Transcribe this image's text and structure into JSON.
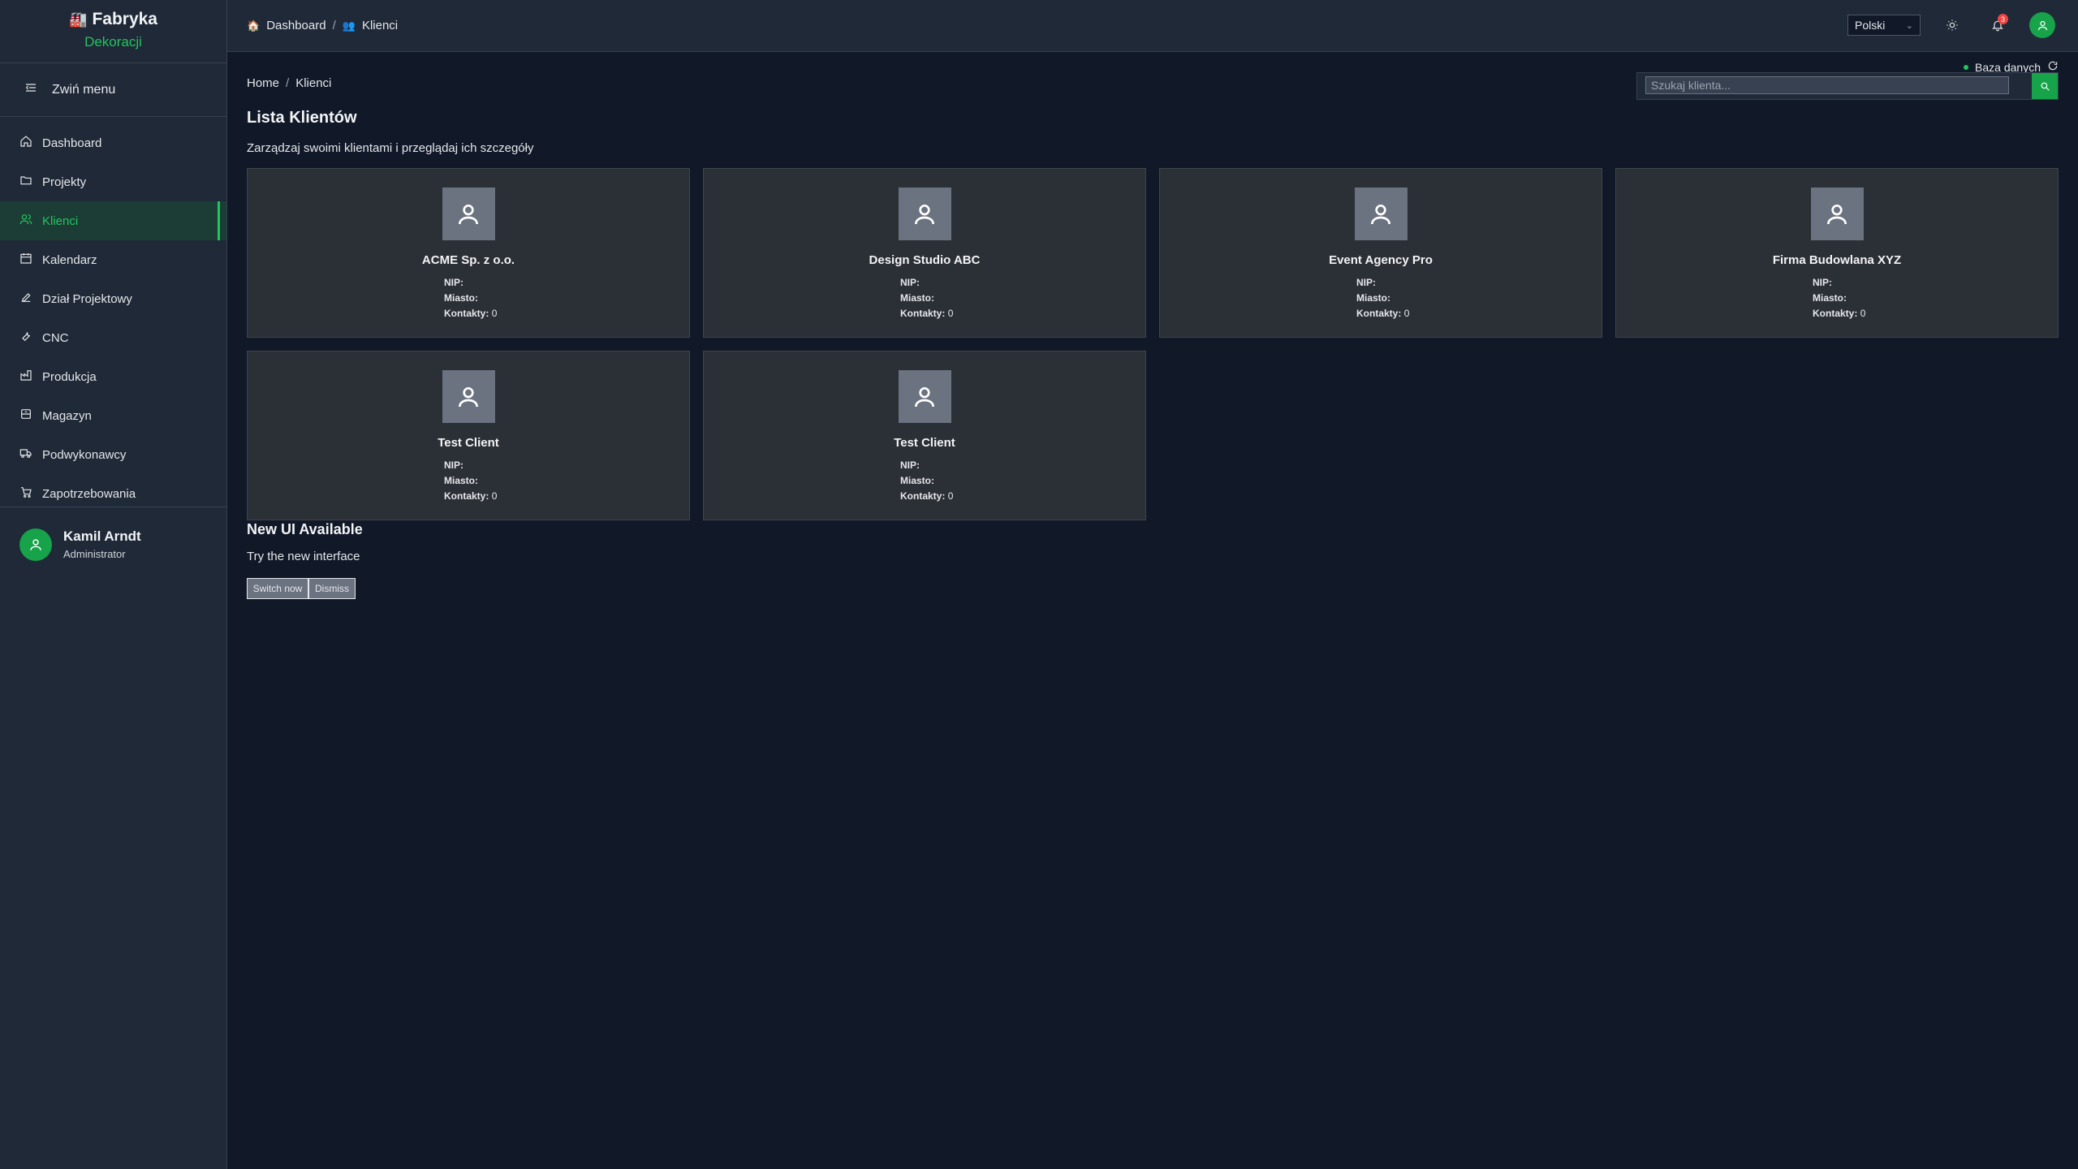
{
  "brand": {
    "title": "Fabryka",
    "subtitle": "Dekoracji",
    "icon": "factory-icon"
  },
  "sidebar": {
    "collapse_label": "Zwiń menu",
    "items": [
      {
        "label": "Dashboard",
        "icon": "home-icon"
      },
      {
        "label": "Projekty",
        "icon": "folder-icon"
      },
      {
        "label": "Klienci",
        "icon": "users-icon",
        "active": true
      },
      {
        "label": "Kalendarz",
        "icon": "calendar-icon"
      },
      {
        "label": "Dział Projektowy",
        "icon": "design-icon"
      },
      {
        "label": "CNC",
        "icon": "wrench-icon"
      },
      {
        "label": "Produkcja",
        "icon": "production-icon"
      },
      {
        "label": "Magazyn",
        "icon": "warehouse-icon"
      },
      {
        "label": "Podwykonawcy",
        "icon": "truck-icon"
      },
      {
        "label": "Zapotrzebowania",
        "icon": "cart-icon"
      }
    ],
    "user": {
      "name": "Kamil Arndt",
      "role": "Administrator"
    }
  },
  "topbar": {
    "crumbs": [
      "Dashboard",
      "/",
      "Klienci"
    ],
    "language": "Polski",
    "notifications_count": "3"
  },
  "main": {
    "db_status": "Baza danych",
    "search_placeholder": "Szukaj klienta...",
    "breadcrumb": [
      "Home",
      "/",
      "Klienci"
    ],
    "title": "Lista Klientów",
    "subtitle": "Zarządzaj swoimi klientami i przeglądaj ich szczegóły",
    "field_labels": {
      "nip": "NIP:",
      "city": "Miasto:",
      "contacts": "Kontakty:"
    },
    "clients": [
      {
        "name": "ACME Sp. z o.o.",
        "nip": "",
        "city": "",
        "contacts": "0"
      },
      {
        "name": "Design Studio ABC",
        "nip": "",
        "city": "",
        "contacts": "0"
      },
      {
        "name": "Event Agency Pro",
        "nip": "",
        "city": "",
        "contacts": "0"
      },
      {
        "name": "Firma Budowlana XYZ",
        "nip": "",
        "city": "",
        "contacts": "0"
      },
      {
        "name": "Test Client",
        "nip": "",
        "city": "",
        "contacts": "0"
      },
      {
        "name": "Test Client",
        "nip": "",
        "city": "",
        "contacts": "0"
      }
    ]
  },
  "promo": {
    "title": "New UI Available",
    "text": "Try the new interface",
    "btn1": "Switch now",
    "btn2": "Dismiss"
  },
  "colors": {
    "accent": "#22c55e",
    "accent_dark": "#16a34a",
    "bg": "#111827",
    "panel": "#1f2937",
    "card": "#2b2f36",
    "badge": "#ef4444"
  }
}
